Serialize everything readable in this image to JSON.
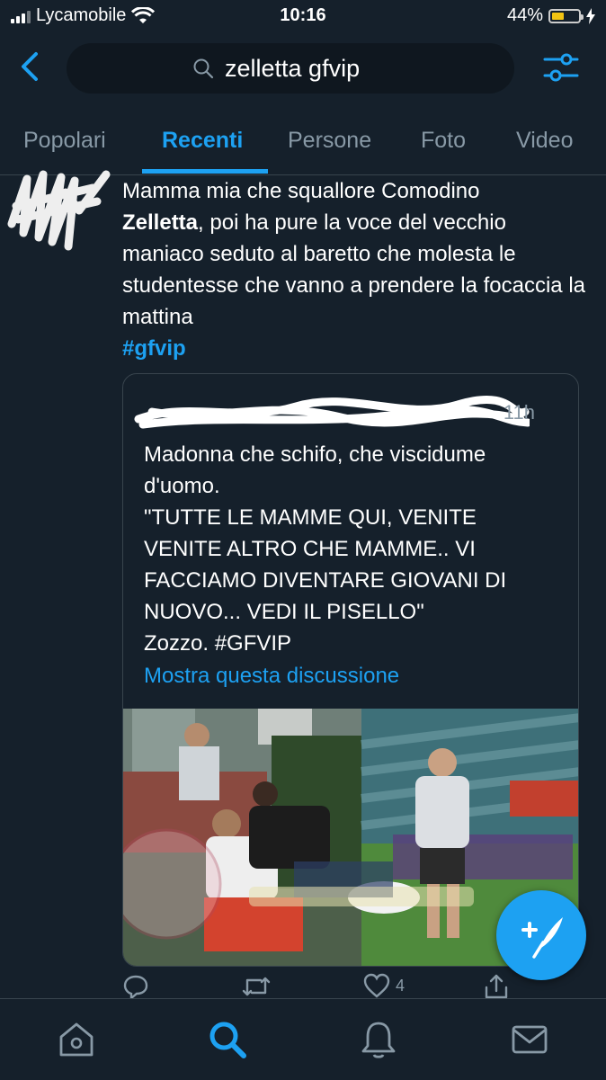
{
  "status_bar": {
    "carrier": "Lycamobile",
    "time": "10:16",
    "battery_percent": "44%",
    "battery_level": 0.44
  },
  "search": {
    "query": "zelletta gfvip",
    "back_icon": "chevron-left-icon",
    "filter_icon": "sliders-icon"
  },
  "tabs": [
    {
      "label": "Popolari",
      "active": false
    },
    {
      "label": "Recenti",
      "active": true
    },
    {
      "label": "Persone",
      "active": false
    },
    {
      "label": "Foto",
      "active": false
    },
    {
      "label": "Video",
      "active": false
    }
  ],
  "tweet": {
    "text_line_1": "Mamma mia che squallore Comodino",
    "bold_word": "Zelletta",
    "text_rest": ", poi ha pure la voce del vecchio maniaco seduto al baretto che molesta le studentesse che vanno a prendere la focaccia la mattina",
    "hashtag": "#gfvip",
    "quoted": {
      "time": "11h",
      "lines": [
        "Madonna che schifo, che viscidume",
        "d'uomo.",
        "\"TUTTE LE MAMME QUI, VENITE",
        "VENITE ALTRO CHE MAMME.. VI",
        "FACCIAMO DIVENTARE GIOVANI DI",
        "NUOVO... VEDI IL PISELLO\"",
        "Zozzo. #GFVIP"
      ],
      "show_thread": "Mostra questa discussione"
    },
    "actions": {
      "reply_count": "",
      "retweet_count": "",
      "like_count": "4"
    }
  },
  "colors": {
    "background": "#15202b",
    "accent": "#1da1f2",
    "muted": "#8899a6",
    "border": "#38444d"
  },
  "bottom_nav": [
    "home-icon",
    "search-icon",
    "bell-icon",
    "mail-icon"
  ]
}
